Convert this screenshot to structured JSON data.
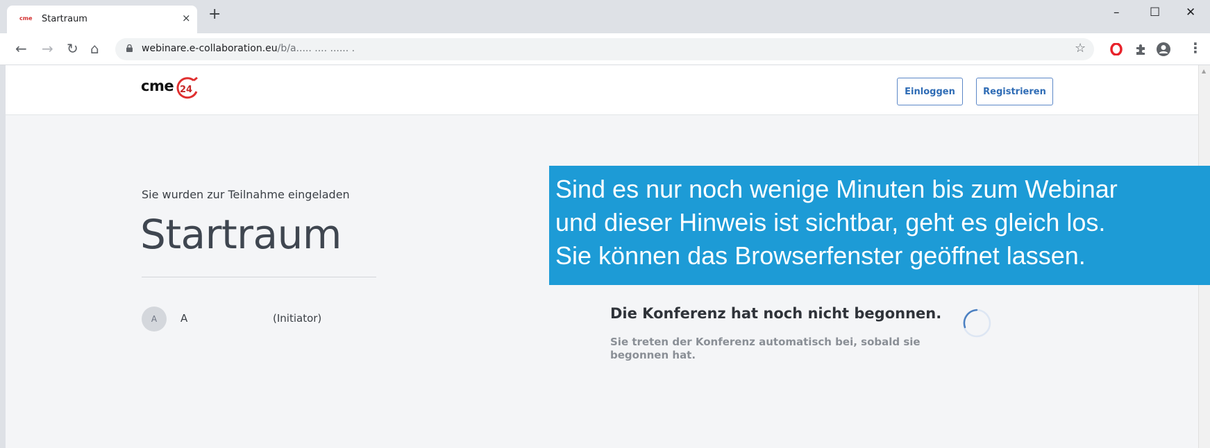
{
  "browser": {
    "tab": {
      "title": "Startraum",
      "close_glyph": "×",
      "favicon": "cme"
    },
    "new_tab_glyph": "+",
    "window_controls": {
      "minimize": "–",
      "maximize": "☐",
      "close": "✕"
    },
    "address": {
      "url_host": "webinare.e-collaboration.eu",
      "url_path": "/b/a..... ....  ......  ."
    },
    "toolbar_icons": [
      "opera-icon",
      "extensions-icon",
      "profile-icon",
      "menu-icon"
    ]
  },
  "header": {
    "logo_text": "cme",
    "logo_badge": "24",
    "login_label": "Einloggen",
    "register_label": "Registrieren"
  },
  "room": {
    "invited_text": "Sie wurden zur Teilnahme eingeladen",
    "title": "Startraum",
    "participant": {
      "avatar_initial": "A",
      "name": "A",
      "role": "(Initiator)"
    }
  },
  "status": {
    "title": "Die Konferenz hat noch nicht begonnen.",
    "subtitle": "Sie treten der Konferenz automatisch bei, sobald sie begonnen hat."
  },
  "overlay": {
    "line1": "Sind es nur noch wenige Minuten bis zum Webinar",
    "line2": "und dieser Hinweis ist sichtbar, geht es gleich los.",
    "line3": "Sie können das Browserfenster geöffnet lassen."
  },
  "colors": {
    "accent": "#2f6cb5",
    "overlay": "#1d9bd6",
    "page_bg": "#f4f5f7"
  }
}
